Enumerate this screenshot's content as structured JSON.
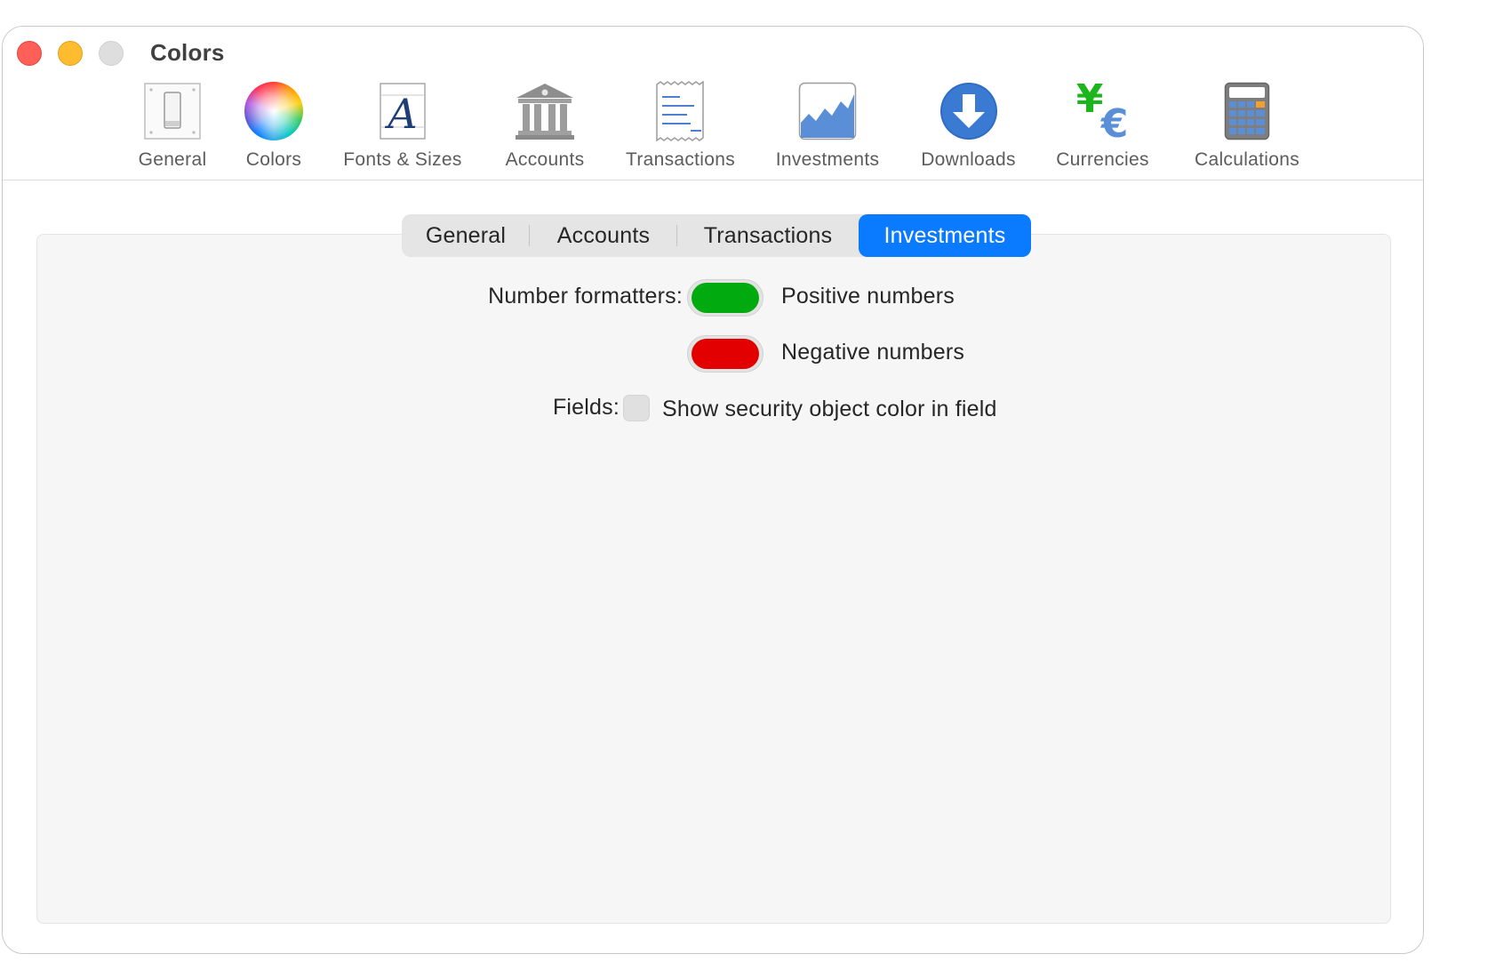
{
  "window": {
    "title": "Colors"
  },
  "toolbar": {
    "items": [
      {
        "label": "General",
        "icon": "general-switch-icon"
      },
      {
        "label": "Colors",
        "icon": "color-wheel-icon"
      },
      {
        "label": "Fonts & Sizes",
        "icon": "font-a-icon"
      },
      {
        "label": "Accounts",
        "icon": "bank-building-icon"
      },
      {
        "label": "Transactions",
        "icon": "receipt-icon"
      },
      {
        "label": "Investments",
        "icon": "area-chart-icon"
      },
      {
        "label": "Downloads",
        "icon": "download-arrow-icon"
      },
      {
        "label": "Currencies",
        "icon": "yen-euro-icon"
      },
      {
        "label": "Calculations",
        "icon": "calculator-icon"
      }
    ],
    "selected": "Colors"
  },
  "tabs": {
    "items": [
      "General",
      "Accounts",
      "Transactions",
      "Investments"
    ],
    "selected": "Investments"
  },
  "investments": {
    "number_formatters_label": "Number formatters:",
    "positive_label": "Positive numbers",
    "positive_color": "#00aa0f",
    "negative_label": "Negative numbers",
    "negative_color": "#e20000",
    "fields_label": "Fields:",
    "show_security_color_label": "Show security object color in field",
    "show_security_color_checked": false
  },
  "colors": {
    "accent": "#0a7aff"
  }
}
